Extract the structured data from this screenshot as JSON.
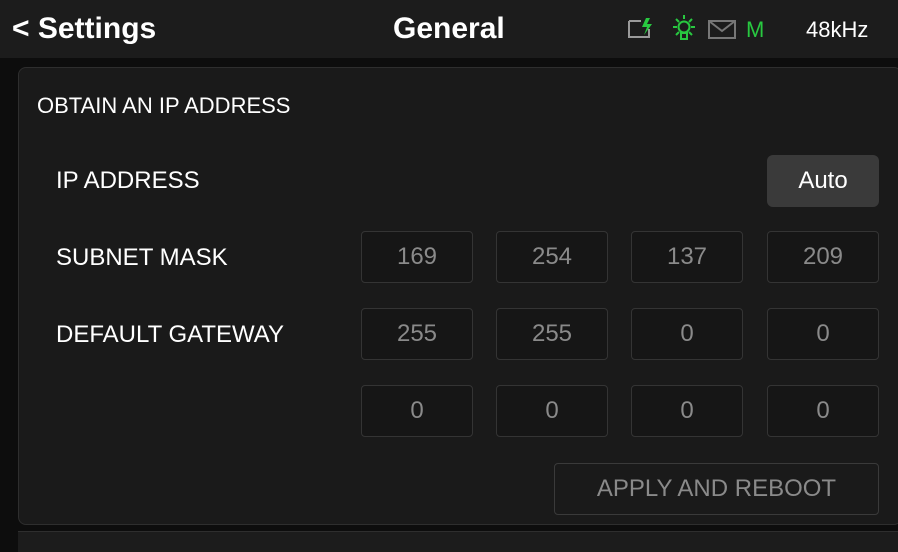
{
  "header": {
    "back_label": "< Settings",
    "title": "General",
    "mode_indicator": "M",
    "sample_rate": "48kHz",
    "status_icons": [
      "battery-charging-icon",
      "lightbulb-icon",
      "mail-icon"
    ],
    "colors": {
      "indicator_green": "#28c840",
      "battery_green": "#28c840",
      "mail_gray": "#777777"
    }
  },
  "section": {
    "title": "OBTAIN AN IP ADDRESS"
  },
  "rows": {
    "ip_address": {
      "label": "IP ADDRESS",
      "mode_button": "Auto"
    },
    "subnet_mask": {
      "label": "SUBNET MASK",
      "octets": [
        "169",
        "254",
        "137",
        "209"
      ]
    },
    "default_gateway": {
      "label": "DEFAULT GATEWAY",
      "octets": [
        "255",
        "255",
        "0",
        "0"
      ]
    },
    "extra": {
      "octets": [
        "0",
        "0",
        "0",
        "0"
      ]
    }
  },
  "actions": {
    "apply_label": "APPLY AND REBOOT"
  }
}
